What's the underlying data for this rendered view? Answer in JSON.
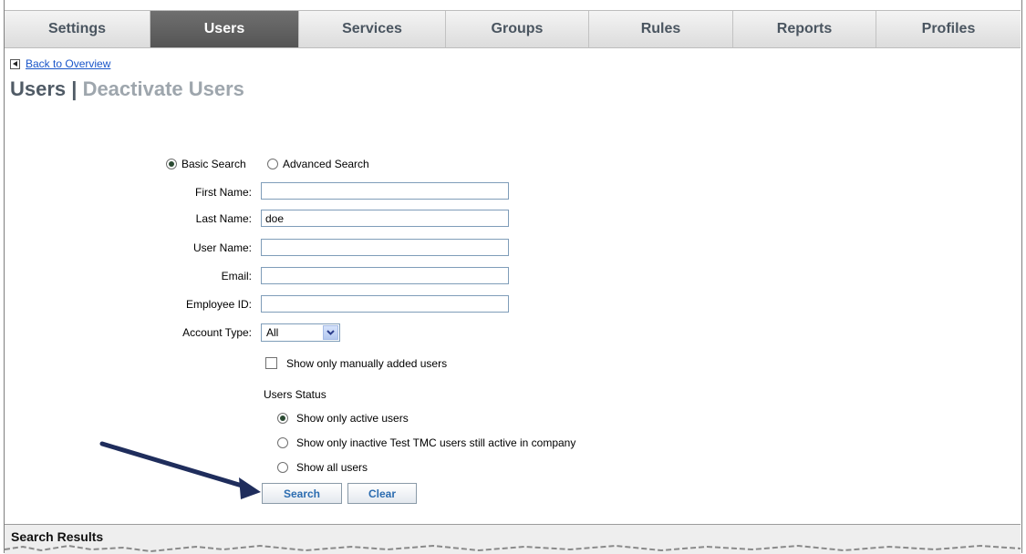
{
  "tabs": [
    "Settings",
    "Users",
    "Services",
    "Groups",
    "Rules",
    "Reports",
    "Profiles"
  ],
  "active_tab": "Users",
  "back_link": "Back to Overview",
  "title": {
    "section": "Users",
    "separator": "|",
    "page": "Deactivate Users"
  },
  "search_mode": {
    "basic": "Basic Search",
    "advanced": "Advanced Search",
    "selected": "basic"
  },
  "fields": {
    "first_name": {
      "label": "First Name:",
      "value": ""
    },
    "last_name": {
      "label": "Last Name:",
      "value": "doe"
    },
    "user_name": {
      "label": "User Name:",
      "value": ""
    },
    "email": {
      "label": "Email:",
      "value": ""
    },
    "employee_id": {
      "label": "Employee ID:",
      "value": ""
    }
  },
  "account_type": {
    "label": "Account Type:",
    "value": "All"
  },
  "manual_users": {
    "label": "Show only manually added users",
    "checked": false
  },
  "users_status": {
    "heading": "Users Status",
    "options": [
      "Show only active users",
      "Show only inactive Test TMC users still active in company",
      "Show all users"
    ],
    "selected": 0
  },
  "buttons": {
    "search": "Search",
    "clear": "Clear"
  },
  "results": {
    "heading": "Search Results"
  },
  "colors": {
    "active_tab": "#5f5f5f",
    "link": "#1a56c9",
    "arrow": "#1f2d5c",
    "button_text": "#2b6cb0"
  }
}
